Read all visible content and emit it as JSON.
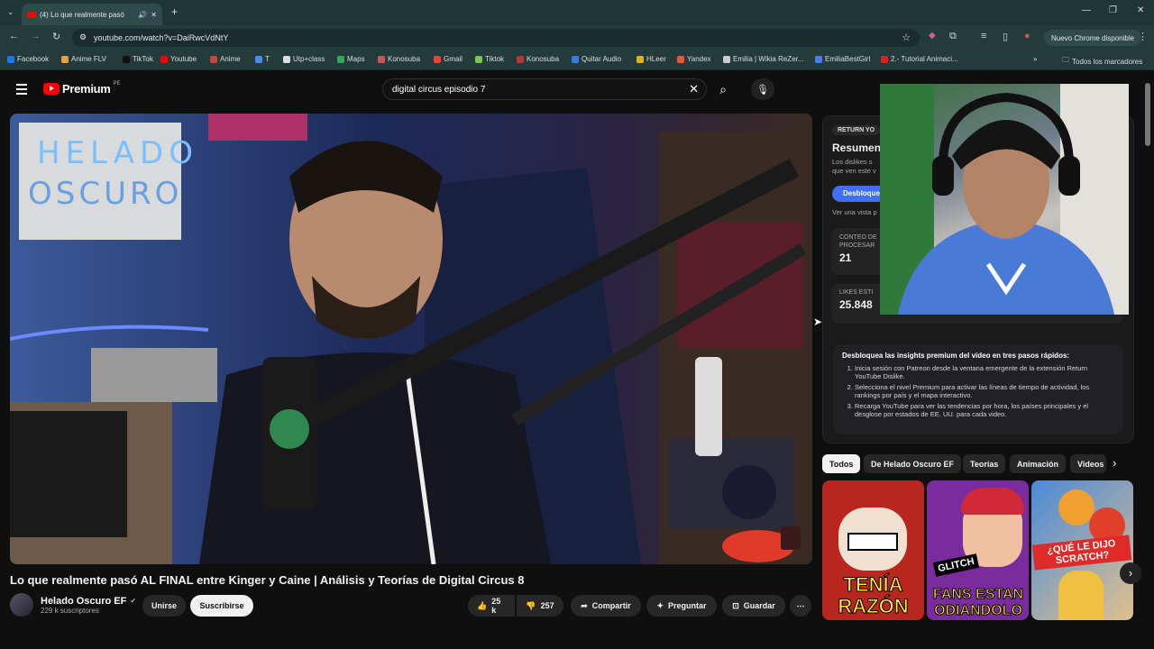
{
  "browser": {
    "tab_title": "(4) Lo que realmente pasó",
    "url": "youtube.com/watch?v=DaiRwcVdNtY",
    "update_label": "Nuevo Chrome disponible",
    "bookmarks": [
      "Facebook",
      "Anime FLV",
      "TikTok",
      "Youtube",
      "Anime",
      "T",
      "Utp+class",
      "Maps",
      "Konosuba",
      "Gmail",
      "Tiktok",
      "Konosuba",
      "Quitar Audio",
      "HLeer",
      "Yandex",
      "Emilia | Wikia ReZer...",
      "EmiliaBestGirl",
      "2.- Tutorial Animaci..."
    ],
    "all_bookmarks": "Todos los marcadores"
  },
  "youtube": {
    "logo": "Premium",
    "logo_region": "PE",
    "search_query": "digital circus episodio 7"
  },
  "video": {
    "title": "Lo que realmente pasó AL FINAL entre Kinger y Caine | Análisis y Teorías de Digital Circus 8",
    "channel": "Helado Oscuro EF",
    "subscribers": "229 k suscriptores",
    "join": "Unirse",
    "subscribe": "Suscribirse",
    "likes": "25 k",
    "dislikes": "257",
    "share": "Compartir",
    "ask": "Preguntar",
    "save": "Guardar",
    "lightbox_text": [
      "HELADO",
      "OSCURO"
    ]
  },
  "ryd": {
    "badge": "RETURN YO",
    "heading": "Resumen",
    "desc": "Los dislikes s que ven este v",
    "button": "Desbloque",
    "link": "Ver una vista p",
    "stat1_label": "CONTEO DE PROCESAR",
    "stat1_value": "21",
    "stat2_label": "LIKES ESTI",
    "stat2_value": "25.848",
    "insights_title": "Desbloquea las insights premium del video en tres pasos rápidos:",
    "insights_steps": [
      "Inicia sesión con Patreon desde la ventana emergente de la extensión Return YouTube Dislike.",
      "Selecciona el nivel Premium para activar las líneas de tiempo de actividad, los rankings por país y el mapa interactivo.",
      "Recarga YouTube para ver las tendencias por hora, los países principales y el desglose por estados de EE. UU. para cada video."
    ]
  },
  "chips": [
    "Todos",
    "De Helado Oscuro EF",
    "Teorías",
    "Animación",
    "Videos"
  ],
  "thumbs": [
    {
      "text": "TENÍA RAZÓN",
      "bg": "#b8261e"
    },
    {
      "text": "FANS ESTAN ODIANDOLO",
      "badge": "GLITCH",
      "bg": "#7a2c9e"
    },
    {
      "text": "¿QUÉ LE DIJO SCRATCH?",
      "bg": "#2e7ab8"
    }
  ],
  "colors": {
    "brand": "#ff0000",
    "chrome": "#243b3c",
    "bg": "#0f0f0f"
  }
}
